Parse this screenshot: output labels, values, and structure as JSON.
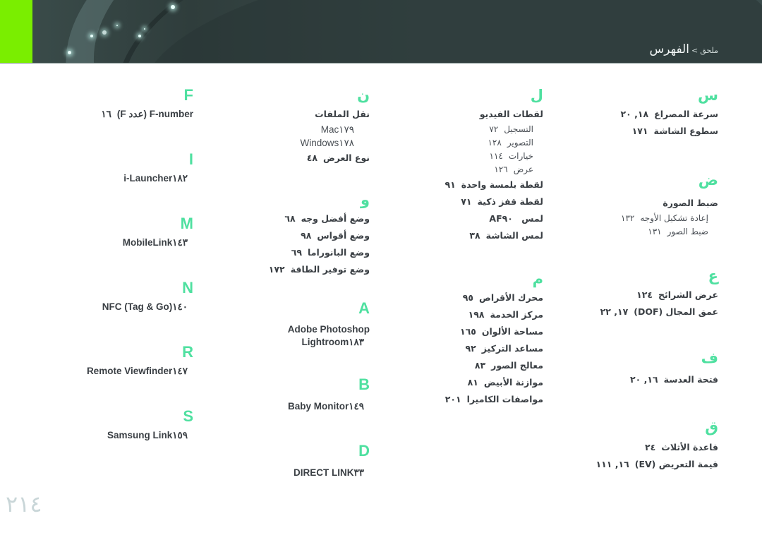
{
  "header": {
    "breadcrumb_parent": "ملحق",
    "breadcrumb_separator": ">",
    "breadcrumb_current": "الفهرس",
    "accent_color": "#7aee00",
    "background_color": "#3a4a49"
  },
  "theme": {
    "letter_color": "#4fe0a0",
    "text_color": "#3a3f44"
  },
  "columns": [
    {
      "sections": [
        {
          "letter": "س",
          "entries": [
            {
              "label": "سرعة المصراع",
              "pages": "١٨, ٢٠"
            },
            {
              "label": "سطوع الشاشة",
              "pages": "١٧١"
            }
          ]
        },
        {
          "letter": "ض",
          "entries": [
            {
              "label": "ضبط الصورة",
              "pages": "",
              "subs": [
                {
                  "label": "إعادة تشكيل الأوجه",
                  "pages": "١٣٢"
                },
                {
                  "label": "ضبط الصور",
                  "pages": "١٣١"
                }
              ]
            }
          ]
        },
        {
          "letter": "ع",
          "entries": [
            {
              "label": "عرض الشرائح",
              "pages": "١٢٤"
            },
            {
              "label": "عمق المجال (DOF)",
              "pages": "١٧, ٢٢"
            }
          ]
        },
        {
          "letter": "ف",
          "entries": [
            {
              "label": "فتحة العدسة",
              "pages": "١٦, ٢٠"
            }
          ]
        },
        {
          "letter": "ق",
          "entries": [
            {
              "label": "قاعدة الأثلاث",
              "pages": "٢٤"
            },
            {
              "label": "قيمة التعريض (EV)",
              "pages": "١٦, ١١١"
            }
          ]
        }
      ]
    },
    {
      "sections": [
        {
          "letter": "ل",
          "entries": [
            {
              "label": "لقطات الفيديو",
              "pages": "",
              "subs": [
                {
                  "label": "التسجيل",
                  "pages": "٧٢"
                },
                {
                  "label": "التصوير",
                  "pages": "١٢٨"
                },
                {
                  "label": "خيارات",
                  "pages": "١١٤"
                },
                {
                  "label": "عرض",
                  "pages": "١٢٦"
                }
              ]
            },
            {
              "label": "لقطة بلمسة واحدة",
              "pages": "٩١"
            },
            {
              "label": "لقطة قفز ذكية",
              "pages": "٧١"
            },
            {
              "label": "لمس AF",
              "pages": "٩٠"
            },
            {
              "label": "لمس الشاشة",
              "pages": "٣٨"
            }
          ]
        },
        {
          "letter": "م",
          "entries": [
            {
              "label": "محرك الأقراص",
              "pages": "٩٥"
            },
            {
              "label": "مركز الخدمة",
              "pages": "١٩٨"
            },
            {
              "label": "مساحة الألوان",
              "pages": "١٦٥"
            },
            {
              "label": "مساعد التركيز",
              "pages": "٩٢"
            },
            {
              "label": "معالج الصور",
              "pages": "٨٣"
            },
            {
              "label": "موازنة الأبيض",
              "pages": "٨١"
            },
            {
              "label": "مواصفات الكاميرا",
              "pages": "٢٠١"
            }
          ]
        }
      ]
    },
    {
      "sections": [
        {
          "letter": "ن",
          "entries": [
            {
              "label": "نقل الملفات",
              "pages": "",
              "subs": [
                {
                  "label": "Mac",
                  "pages": "١٧٩",
                  "latin": true
                },
                {
                  "label": "Windows",
                  "pages": "١٧٨",
                  "latin": true
                }
              ]
            },
            {
              "label": "نوع العرض",
              "pages": "٤٨"
            }
          ]
        },
        {
          "letter": "و",
          "entries": [
            {
              "label": "وضع أفضل وجه",
              "pages": "٦٨"
            },
            {
              "label": "وضع أقواس",
              "pages": "٩٨"
            },
            {
              "label": "وضع البانوراما",
              "pages": "٦٩"
            },
            {
              "label": "وضع توفير الطاقة",
              "pages": "١٧٢"
            }
          ]
        },
        {
          "letter": "A",
          "latin": true,
          "entries": [
            {
              "label": "Adobe Photoshop",
              "pages": "",
              "latin": true
            },
            {
              "label": "Lightroom",
              "pages": "١٨٣",
              "latin": true
            }
          ]
        },
        {
          "letter": "B",
          "latin": true,
          "entries": [
            {
              "label": "Baby Monitor",
              "pages": "١٤٩",
              "latin": true
            }
          ]
        },
        {
          "letter": "D",
          "latin": true,
          "entries": [
            {
              "label": "DIRECT LINK",
              "pages": "٣٣",
              "latin": true
            }
          ]
        }
      ]
    },
    {
      "sections": [
        {
          "letter": "F",
          "latin": true,
          "entries": [
            {
              "label": "F-number (عدد F)",
              "pages": "١٦",
              "latin": true
            }
          ]
        },
        {
          "letter": "I",
          "latin": true,
          "entries": [
            {
              "label": "i-Launcher",
              "pages": "١٨٢",
              "latin": true
            }
          ]
        },
        {
          "letter": "M",
          "latin": true,
          "entries": [
            {
              "label": "MobileLink",
              "pages": "١٤٣",
              "latin": true
            }
          ]
        },
        {
          "letter": "N",
          "latin": true,
          "entries": [
            {
              "label": "NFC (Tag & Go)",
              "pages": "١٤٠",
              "latin": true
            }
          ]
        },
        {
          "letter": "R",
          "latin": true,
          "entries": [
            {
              "label": "Remote Viewfinder",
              "pages": "١٤٧",
              "latin": true
            }
          ]
        },
        {
          "letter": "S",
          "latin": true,
          "entries": [
            {
              "label": "Samsung Link",
              "pages": "١٥٩",
              "latin": true
            }
          ]
        }
      ]
    }
  ],
  "footer": {
    "page_number": "٢١٤"
  }
}
